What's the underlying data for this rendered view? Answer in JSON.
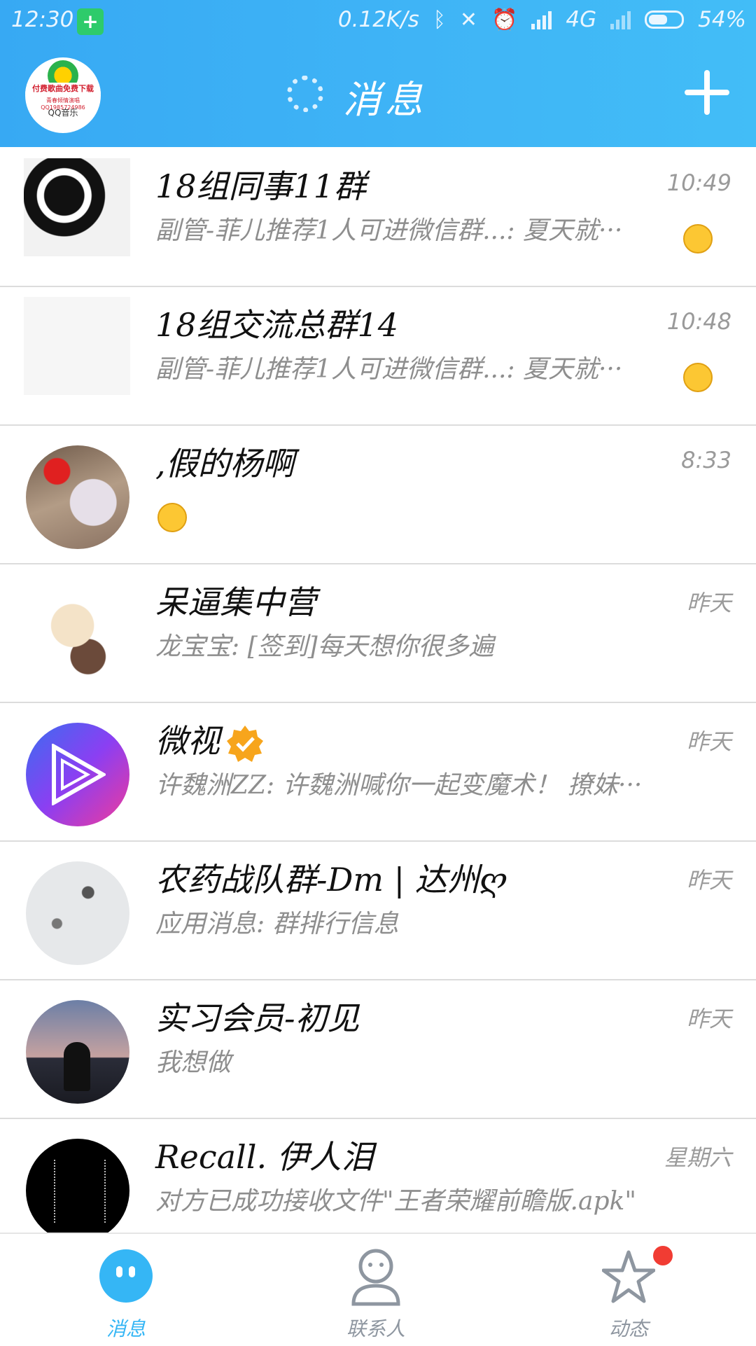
{
  "status_bar": {
    "time": "12:30",
    "net_speed": "0.12K/s",
    "network": "4G",
    "battery": "54%"
  },
  "header": {
    "title": "消息",
    "app_avatar_banner": "付费歌曲免费下载",
    "app_avatar_sub": "青春倾情演唱QQ1985724986",
    "app_avatar_brand": "QQ音乐"
  },
  "conversations": [
    {
      "name": "18组同事11群",
      "time": "10:49",
      "preview": "副管-菲儿推荐1人可进微信群...: 夏天就···"
    },
    {
      "name": "18组交流总群14",
      "time": "10:48",
      "preview": "副管-菲儿推荐1人可进微信群...: 夏天就···"
    },
    {
      "name": ",假的杨啊",
      "time": "8:33",
      "preview": ""
    },
    {
      "name": "呆逼集中营",
      "time": "昨天",
      "preview": "龙宝宝: [签到]每天想你很多遍"
    },
    {
      "name": "微视",
      "time": "昨天",
      "preview": "许魏洲ZZ: 许魏洲喊你一起变魔术！ 撩妹···"
    },
    {
      "name": "农药战队群-Dm | 达州ღ",
      "time": "昨天",
      "preview": "应用消息: 群排行信息"
    },
    {
      "name": "实习会员-初见",
      "time": "昨天",
      "preview": "我想做"
    },
    {
      "name": "Recall.  伊人泪",
      "time": "星期六",
      "preview": "对方已成功接收文件\"王者荣耀前瞻版.apk\""
    }
  ],
  "tabs": [
    {
      "label": "消息",
      "active": true
    },
    {
      "label": "联系人",
      "active": false
    },
    {
      "label": "动态",
      "active": false
    }
  ],
  "colors": {
    "header": "#3fb4f6",
    "accent": "#35b6f5",
    "badge": "#f13c33"
  }
}
